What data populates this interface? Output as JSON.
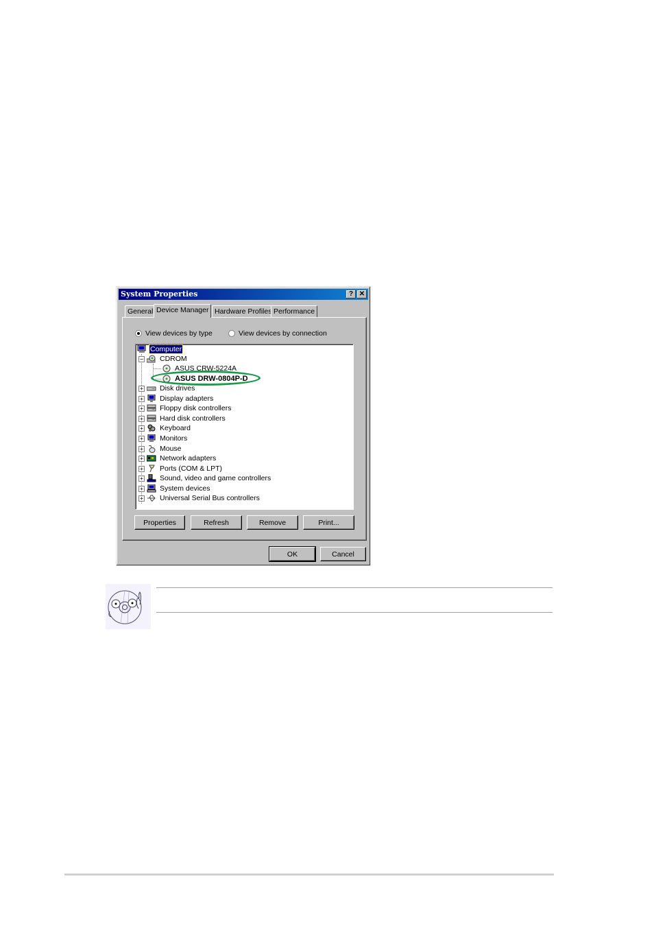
{
  "dialog": {
    "title": "System Properties",
    "help_button": "?",
    "close_button": "✕",
    "tabs": [
      {
        "label": "General",
        "active": false
      },
      {
        "label": "Device Manager",
        "active": true
      },
      {
        "label": "Hardware Profiles",
        "active": false
      },
      {
        "label": "Performance",
        "active": false
      }
    ],
    "view_options": [
      {
        "label": "View devices by type",
        "checked": true
      },
      {
        "label": "View devices by connection",
        "checked": false
      }
    ],
    "tree": {
      "root": {
        "label": "Computer",
        "icon": "computer-icon",
        "selected": true
      },
      "items": [
        {
          "label": "CDROM",
          "icon": "cdrom-icon",
          "expanded": true,
          "children": [
            {
              "label": "ASUS CRW-5224A",
              "icon": "cd-disc-icon"
            },
            {
              "label": "ASUS DRW-0804P-D",
              "icon": "cd-disc-icon",
              "highlighted": true
            }
          ]
        },
        {
          "label": "Disk drives",
          "icon": "disk-drive-icon"
        },
        {
          "label": "Display adapters",
          "icon": "display-adapter-icon"
        },
        {
          "label": "Floppy disk controllers",
          "icon": "floppy-controller-icon"
        },
        {
          "label": "Hard disk controllers",
          "icon": "hard-disk-controller-icon"
        },
        {
          "label": "Keyboard",
          "icon": "keyboard-icon"
        },
        {
          "label": "Monitors",
          "icon": "monitor-icon"
        },
        {
          "label": "Mouse",
          "icon": "mouse-icon"
        },
        {
          "label": "Network adapters",
          "icon": "network-adapter-icon"
        },
        {
          "label": "Ports (COM & LPT)",
          "icon": "port-icon"
        },
        {
          "label": "Sound, video and game controllers",
          "icon": "sound-controller-icon"
        },
        {
          "label": "System devices",
          "icon": "system-devices-icon"
        },
        {
          "label": "Universal Serial Bus controllers",
          "icon": "usb-icon"
        }
      ],
      "expand_symbol": "+",
      "collapse_symbol": "−"
    },
    "buttons": {
      "properties": "Properties",
      "refresh": "Refresh",
      "remove": "Remove",
      "print": "Print...",
      "ok": "OK",
      "cancel": "Cancel"
    },
    "colors": {
      "titlebar_start": "#000080",
      "titlebar_end": "#1084d0",
      "highlight_ellipse": "#1a9a4a",
      "face": "#c0c0c0"
    }
  },
  "note": {
    "icon": "cd-mascot-icon"
  }
}
